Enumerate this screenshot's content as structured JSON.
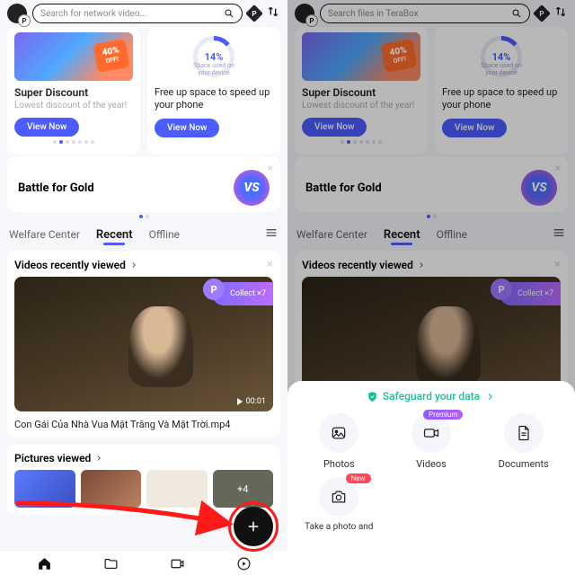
{
  "left": {
    "search_placeholder": "Search for network video...",
    "promo": {
      "title": "Super Discount",
      "subtitle": "Lowest discount of the year!",
      "off_pct": "40%",
      "off_lbl": "OFF!",
      "btn": "View Now"
    },
    "space": {
      "pct": "14%",
      "pct_lbl": "Space used on your device",
      "desc": "Free up space to speed up your phone",
      "btn": "View Now"
    },
    "battle": {
      "title": "Battle for Gold",
      "vs": "VS"
    },
    "tabs": {
      "welfare": "Welfare Center",
      "recent": "Recent",
      "offline": "Offline"
    },
    "videos": {
      "header": "Videos recently viewed",
      "collect": "Collect ×7",
      "time": "00:01",
      "name": "Con Gái Của Nhà Vua  Mặt Trăng Và Mặt Trời.mp4"
    },
    "pictures": {
      "header": "Pictures viewed",
      "more_overlay": "+4"
    }
  },
  "right": {
    "search_placeholder": "Search files in TeraBox",
    "sheet": {
      "header": "Safeguard your data",
      "items": [
        "Photos",
        "Videos",
        "Documents"
      ],
      "item4": "Take a photo and",
      "badge_premium": "Premium",
      "badge_new": "New"
    }
  }
}
